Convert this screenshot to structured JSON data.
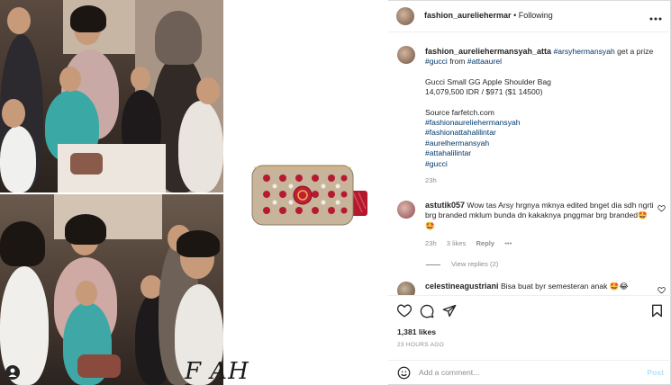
{
  "header": {
    "username": "fashion_aureliehermar",
    "separator": "•",
    "follow_status": "Following",
    "more_icon": "more-horizontal-icon"
  },
  "media": {
    "watermark": "F AH"
  },
  "caption": {
    "username": "fashion_aureliehermansyah_atta",
    "mention1": "#arsyhermansyah",
    "text1": "get a prize",
    "mention2": "#gucci",
    "text2": "from",
    "mention3": "#attaaurel",
    "line_product": "Gucci Small GG Apple Shoulder Bag",
    "line_price": "14,079,500 IDR / $971 ($1 14500)",
    "line_source": "Source farfetch.com",
    "hashtags": [
      "#fashionaureliehermansyah",
      "#fashionattahalilintar",
      "#aurelhermansyah",
      "#attahalilintar",
      "#gucci"
    ],
    "time": "23h"
  },
  "comments": [
    {
      "username": "astutik057",
      "text": "Wow tas Arsy hrgnya mknya edited bnget dia sdh ngrti brg branded mklum bunda dn kakaknya pnggmar brg branded🤩🤩",
      "time": "23h",
      "likes": "3 likes",
      "reply": "Reply",
      "more": "•••",
      "view_replies": "View replies (2)"
    },
    {
      "username": "celestineagustriani",
      "text": "Bisa buat byr semesteran anak 🤩😂"
    }
  ],
  "actions": {
    "likes": "1,381 likes",
    "time_ago": "23 HOURS AGO"
  },
  "add_comment": {
    "placeholder": "Add a comment...",
    "post_label": "Post"
  },
  "colors": {
    "link": "#00376b",
    "muted": "#8e8e8e",
    "post_disabled": "#b2dffc"
  }
}
